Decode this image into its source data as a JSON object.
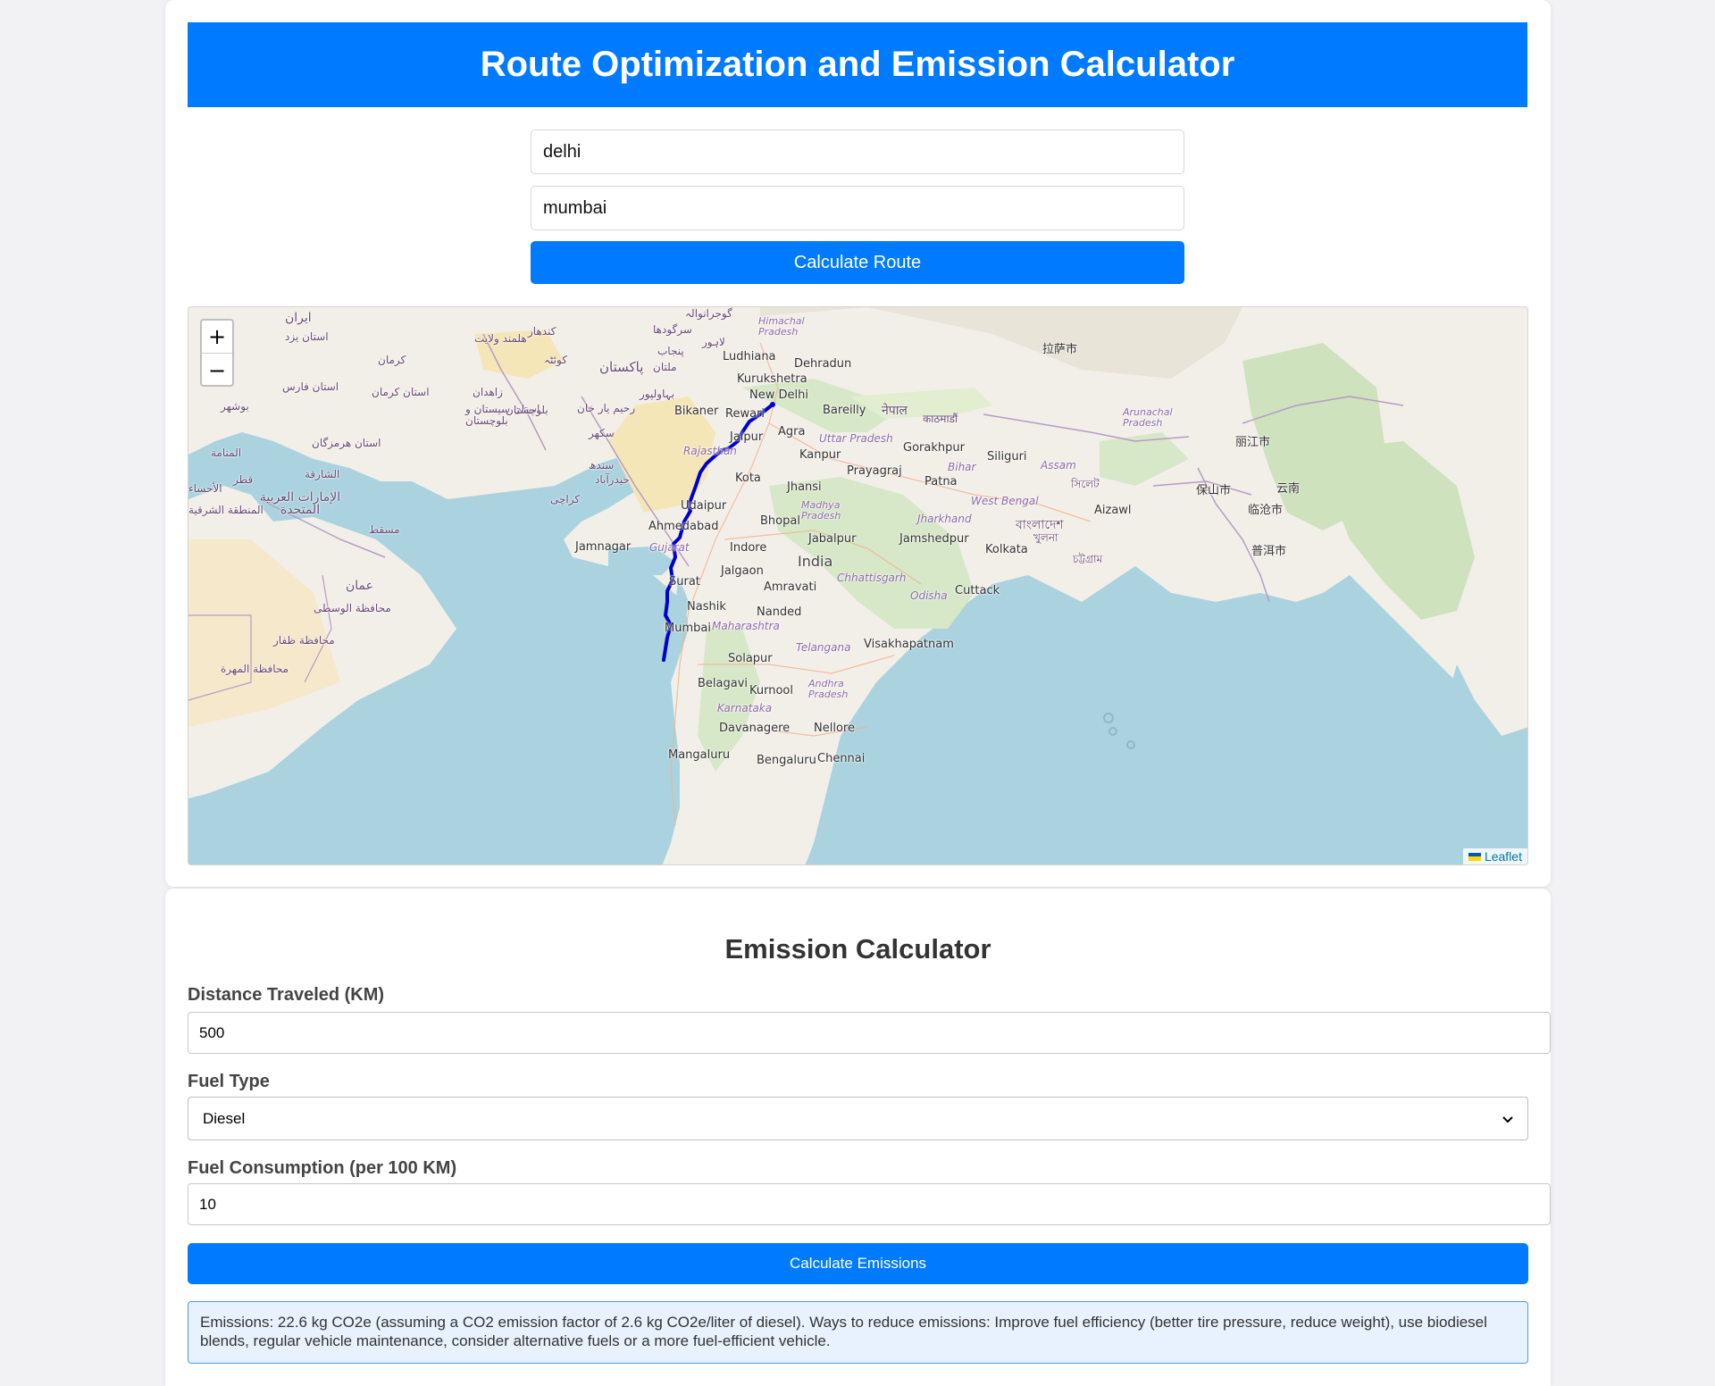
{
  "header": {
    "title": "Route Optimization and Emission Calculator"
  },
  "route_form": {
    "origin_value": "delhi",
    "destination_value": "mumbai",
    "calculate_label": "Calculate Route"
  },
  "map": {
    "zoom_in": "+",
    "zoom_out": "−",
    "attribution": "Leaflet",
    "labels": {
      "iran": "ایران",
      "yazd": "استان یزد",
      "kerman": "کرمان",
      "fars": "استان فارس",
      "kerman_prov": "استان کرمان",
      "bushehr": "بوشهر",
      "zahedan": "زاهدان",
      "sistan": "استان سیستان و بلوچستان",
      "hormozgan": "استان هرمزگان",
      "manama": "المنامة",
      "qatar": "قطر",
      "sharjah": "الشارقة",
      "uae": "الإمارات العربية المتحدة",
      "ahsa": "الأحساء",
      "eastern": "المنطقة الشرقية",
      "muscat": "مسقط",
      "oman": "عمان",
      "wusta": "محافظة الوسطى",
      "dhofar": "محافظة ظفار",
      "mahra": "محافظة المهرة",
      "kandahar": "کندهار",
      "helmand": "هلمند ولایت",
      "quetta": "کوئٹہ",
      "balochistan": "بلوچستان",
      "pakistan": "پاکستان",
      "multan": "ملتان",
      "sargodha": "سرگودھا",
      "gujranwala": "گوجرانوالہ",
      "lahore": "لاہور",
      "punjab": "پنجاب",
      "bahawalpur": "بہاولپور",
      "rahimyar": "رحیم یار خان",
      "sukkur": "سکھر",
      "sindh": "سندھ",
      "hyderabad": "حیدرآباد",
      "karachi": "کراچی",
      "himachal": "Himachal Pradesh",
      "ludhiana": "Ludhiana",
      "dehradun": "Dehradun",
      "kurukshetra": "Kurukshetra",
      "new_delhi": "New Delhi",
      "bikaner": "Bikaner",
      "rewari": "Rewari",
      "bareilly": "Bareilly",
      "agra": "Agra",
      "jaipur": "Jaipur",
      "rajasthan": "Rajasthan",
      "uttar_pradesh": "Uttar Pradesh",
      "kanpur": "Kanpur",
      "gorakhpur": "Gorakhpur",
      "prayagraj": "Prayagraj",
      "kota": "Kota",
      "jhansi": "Jhansi",
      "bihar": "Bihar",
      "patna": "Patna",
      "udaipur": "Udaipur",
      "madhya_pradesh": "Madhya Pradesh",
      "bhopal": "Bhopal",
      "ahmedabad": "Ahmedabad",
      "gujarat": "Gujarat",
      "jamnagar": "Jamnagar",
      "indore": "Indore",
      "jabalpur": "Jabalpur",
      "jharkhand": "Jharkhand",
      "jamshedpur": "Jamshedpur",
      "india": "India",
      "jalgaon": "Jalgaon",
      "chhattisgarh": "Chhattisgarh",
      "surat": "Surat",
      "amravati": "Amravati",
      "nashik": "Nashik",
      "nanded": "Nanded",
      "odisha": "Odisha",
      "cuttack": "Cuttack",
      "mumbai": "Mumbai",
      "maharashtra": "Maharashtra",
      "telangana": "Telangana",
      "visakhapatnam": "Visakhapatnam",
      "solapur": "Solapur",
      "belagavi": "Belagavi",
      "kurnool": "Kurnool",
      "andhra": "Andhra Pradesh",
      "karnataka": "Karnataka",
      "davanagere": "Davanagere",
      "nellore": "Nellore",
      "mangaluru": "Mangaluru",
      "bengaluru": "Bengaluru",
      "chennai": "Chennai",
      "nepal": "नेपाल",
      "kathmandu": "काठमाडौं",
      "siliguri": "Siliguri",
      "assam": "Assam",
      "west_bengal": "West Bengal",
      "kolkata": "Kolkata",
      "bangladesh": "বাংলাদেশ",
      "khulna": "খুলনা",
      "chattogram": "চট্টগ্রাম",
      "sylhet": "সিলেট",
      "aizawl": "Aizawl",
      "arunachal": "Arunachal Pradesh",
      "lhasa": "拉萨市",
      "lijiang": "丽江市",
      "baoshan": "保山市",
      "lincang": "临沧市",
      "puer": "普洱市",
      "yunnan": "云南"
    }
  },
  "emission": {
    "title": "Emission Calculator",
    "distance_label": "Distance Traveled (KM)",
    "distance_value": "500",
    "fuel_type_label": "Fuel Type",
    "fuel_type_value": "Diesel",
    "consumption_label": "Fuel Consumption (per 100 KM)",
    "consumption_value": "10",
    "calculate_label": "Calculate Emissions",
    "result": "Emissions: 22.6 kg CO2e (assuming a CO2 emission factor of 2.6 kg CO2e/liter of diesel). Ways to reduce emissions: Improve fuel efficiency (better tire pressure, reduce weight), use biodiesel blends, regular vehicle maintenance, consider alternative fuels or a more fuel-efficient vehicle."
  },
  "colors": {
    "accent": "#007bff",
    "route_line": "#0000cc",
    "sea": "#aad3df",
    "land": "#f2efe9",
    "result_bg": "#e7f2fe"
  }
}
